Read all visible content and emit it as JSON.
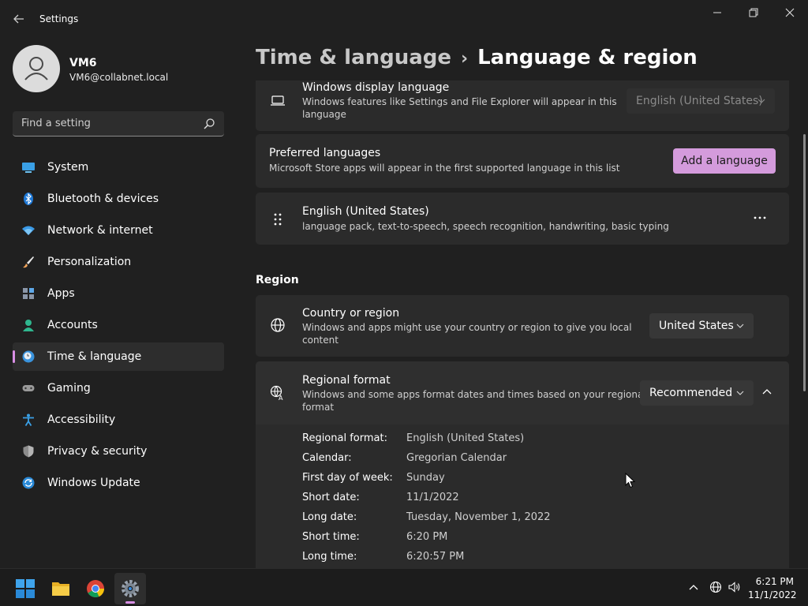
{
  "window": {
    "app_title": "Settings"
  },
  "user": {
    "name": "VM6",
    "email": "VM6@collabnet.local"
  },
  "search": {
    "placeholder": "Find a setting"
  },
  "sidebar": {
    "items": [
      {
        "label": "System",
        "icon": "system-icon"
      },
      {
        "label": "Bluetooth & devices",
        "icon": "bluetooth-icon"
      },
      {
        "label": "Network & internet",
        "icon": "wifi-icon"
      },
      {
        "label": "Personalization",
        "icon": "brush-icon"
      },
      {
        "label": "Apps",
        "icon": "apps-icon"
      },
      {
        "label": "Accounts",
        "icon": "person-icon"
      },
      {
        "label": "Time & language",
        "icon": "clock-globe-icon",
        "active": true
      },
      {
        "label": "Gaming",
        "icon": "gamepad-icon"
      },
      {
        "label": "Accessibility",
        "icon": "accessibility-icon"
      },
      {
        "label": "Privacy & security",
        "icon": "shield-icon"
      },
      {
        "label": "Windows Update",
        "icon": "update-icon"
      }
    ]
  },
  "breadcrumb": {
    "parent": "Time & language",
    "separator": "›",
    "current": "Language & region"
  },
  "main": {
    "display_language": {
      "title": "Windows display language",
      "desc_line1": "Windows features like Settings and File Explorer will appear in this",
      "desc_line2": "language",
      "value": "English (United States)"
    },
    "preferred": {
      "title": "Preferred languages",
      "desc": "Microsoft Store apps will appear in the first supported language in this list",
      "button": "Add a language"
    },
    "language_item": {
      "title": "English (United States)",
      "desc": "language pack, text-to-speech, speech recognition, handwriting, basic typing",
      "more": "..."
    },
    "region": {
      "section_title": "Region",
      "country": {
        "title": "Country or region",
        "desc_line1": "Windows and apps might use your country or region to give you local",
        "desc_line2": "content",
        "value": "United States"
      },
      "format": {
        "title": "Regional format",
        "desc_line1": "Windows and some apps format dates and times based on your regional",
        "desc_line2": "format",
        "value": "Recommended"
      },
      "details": [
        {
          "label": "Regional format:",
          "value": "English (United States)"
        },
        {
          "label": "Calendar:",
          "value": "Gregorian Calendar"
        },
        {
          "label": "First day of week:",
          "value": "Sunday"
        },
        {
          "label": "Short date:",
          "value": "11/1/2022"
        },
        {
          "label": "Long date:",
          "value": "Tuesday, November 1, 2022"
        },
        {
          "label": "Short time:",
          "value": "6:20 PM"
        },
        {
          "label": "Long time:",
          "value": "6:20:57 PM"
        }
      ]
    }
  },
  "taskbar": {
    "apps": [
      "start-icon",
      "file-explorer-icon",
      "chrome-icon",
      "settings-icon"
    ],
    "time": "6:21 PM",
    "date": "11/1/2022"
  },
  "colors": {
    "accent": "#d49bdc",
    "background": "#202020",
    "card": "#2b2b2b"
  }
}
